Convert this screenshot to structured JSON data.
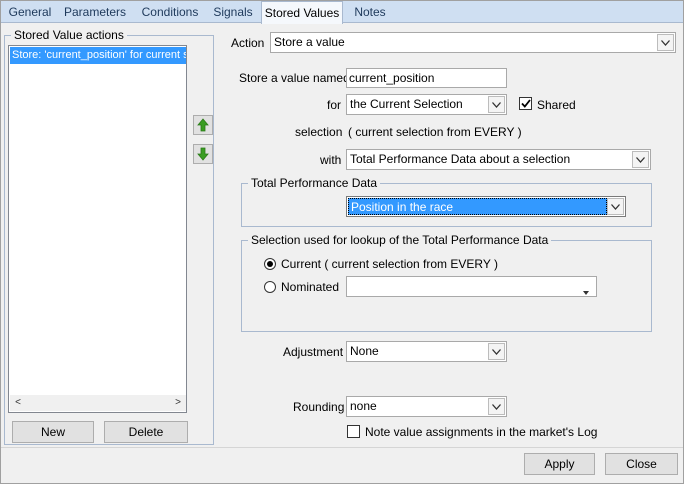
{
  "tabs": [
    {
      "label": "General"
    },
    {
      "label": "Parameters"
    },
    {
      "label": "Conditions"
    },
    {
      "label": "Signals"
    },
    {
      "label": "Stored Values"
    },
    {
      "label": "Notes"
    }
  ],
  "left_panel": {
    "title": "Stored Value actions",
    "items": [
      "Store: 'current_position' for current se"
    ],
    "new_label": "New",
    "delete_label": "Delete"
  },
  "form": {
    "action_label": "Action",
    "action_value": "Store a value",
    "store_label": "Store a value named",
    "store_value": "current_position",
    "for_label": "for",
    "for_value": "the Current Selection",
    "shared_label": "Shared",
    "shared_checked": true,
    "selection_label": "selection",
    "selection_value": "( current selection from EVERY )",
    "with_label": "with",
    "with_value": "Total Performance Data about a selection",
    "tpd_group_title": "Total Performance Data",
    "tpd_value": "Position in the race",
    "lookup_group_title": "Selection used for lookup of the Total Performance Data",
    "current_radio_label": "Current ( current selection from EVERY )",
    "nominated_radio_label": "Nominated",
    "nominated_value": "",
    "adjustment_label": "Adjustment",
    "adjustment_value": "None",
    "rounding_label": "Rounding",
    "rounding_value": "none",
    "note_label": "Note value assignments in the market's Log",
    "note_checked": false
  },
  "footer": {
    "apply_label": "Apply",
    "close_label": "Close"
  },
  "colors": {
    "selection_blue": "#3399ff",
    "tab_bg": "#cfdff2",
    "arrow_green": "#3a9d23"
  }
}
